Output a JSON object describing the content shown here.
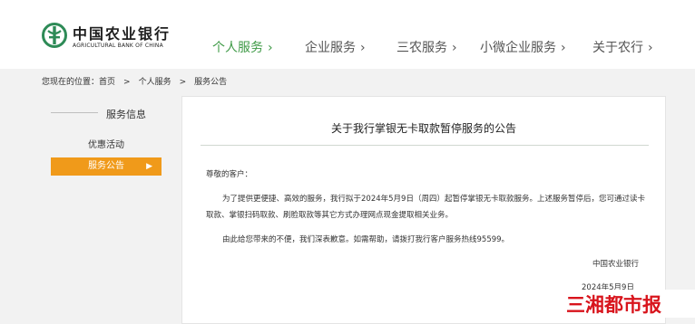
{
  "header": {
    "logo": {
      "cn": "中国农业银行",
      "en": "AGRICULTURAL BANK OF CHINA",
      "emblem_color": "#2e8b57"
    },
    "nav": [
      {
        "label": "个人服务",
        "active": true
      },
      {
        "label": "企业服务",
        "active": false
      },
      {
        "label": "三农服务",
        "active": false
      },
      {
        "label": "小微企业服务",
        "active": false
      },
      {
        "label": "关于农行",
        "active": false
      }
    ],
    "chevron": "›",
    "accent": "#3f9a47"
  },
  "breadcrumb": {
    "prefix": "您现在的位置：",
    "items": [
      "首页",
      ">",
      "个人服务",
      ">",
      "服务公告"
    ]
  },
  "sidebar": {
    "title": "服务信息",
    "items": [
      {
        "label": "优惠活动",
        "active": false
      },
      {
        "label": "服务公告",
        "active": true
      }
    ],
    "active_arrow": "▶",
    "active_color": "#f09a1a"
  },
  "notice": {
    "title": "关于我行掌银无卡取款暂停服务的公告",
    "greeting": "尊敬的客户：",
    "para1_line1": "为了提供更便捷、高效的服务，我行拟于2024年5月9日（周四）起暂停掌银无卡取款服务。上述服务暂停后，您可通过读卡",
    "para1_line2": "取款、掌银扫码取款、刷脸取款等其它方式办理网点现金提取相关业务。",
    "para2": "由此给您带来的不便，我们深表歉意。如需帮助，请拨打我行客户服务热线95599。",
    "signature": "中国农业银行",
    "date": "2024年5月9日"
  },
  "watermark": {
    "text": "三湘都市报",
    "color": "#d8141c"
  }
}
